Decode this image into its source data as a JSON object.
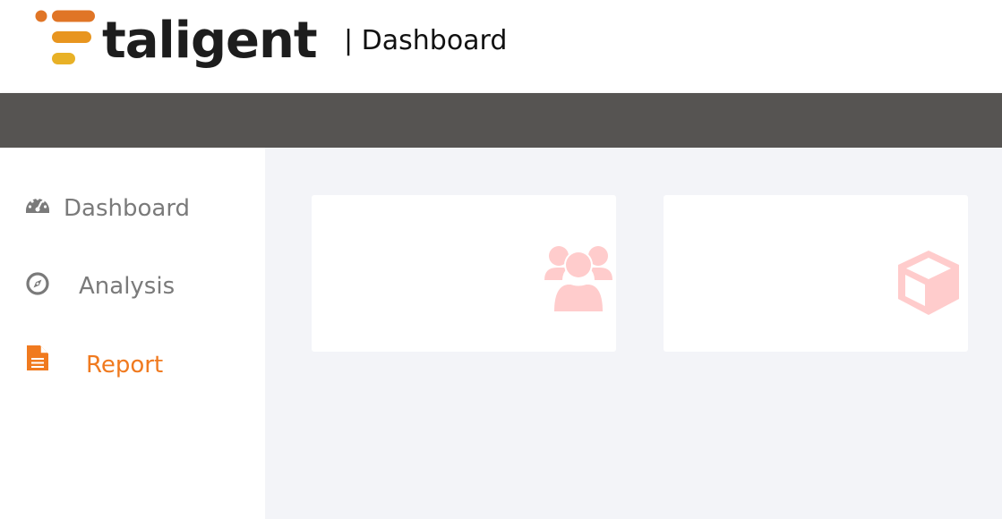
{
  "brand": {
    "name": "taligent",
    "colors": {
      "orange": "#e07526",
      "yellow": "#e8b126",
      "text": "#1d1d1d"
    }
  },
  "header": {
    "heading": "| Dashboard"
  },
  "sidebar": {
    "items": [
      {
        "label": "Dashboard",
        "icon": "speedometer-icon",
        "active": false
      },
      {
        "label": "Analysis",
        "icon": "compass-icon",
        "active": false
      },
      {
        "label": "Report",
        "icon": "document-icon",
        "active": true
      }
    ],
    "active_color": "#f07a1f",
    "inactive_color": "#7a7a7a"
  },
  "cards": [
    {
      "icon": "users-group-icon",
      "icon_color": "#ffcccc"
    },
    {
      "icon": "cube-icon",
      "icon_color": "#ffcccc"
    }
  ],
  "colors": {
    "toolbar": "#565452",
    "content_bg": "#f3f4f8"
  }
}
